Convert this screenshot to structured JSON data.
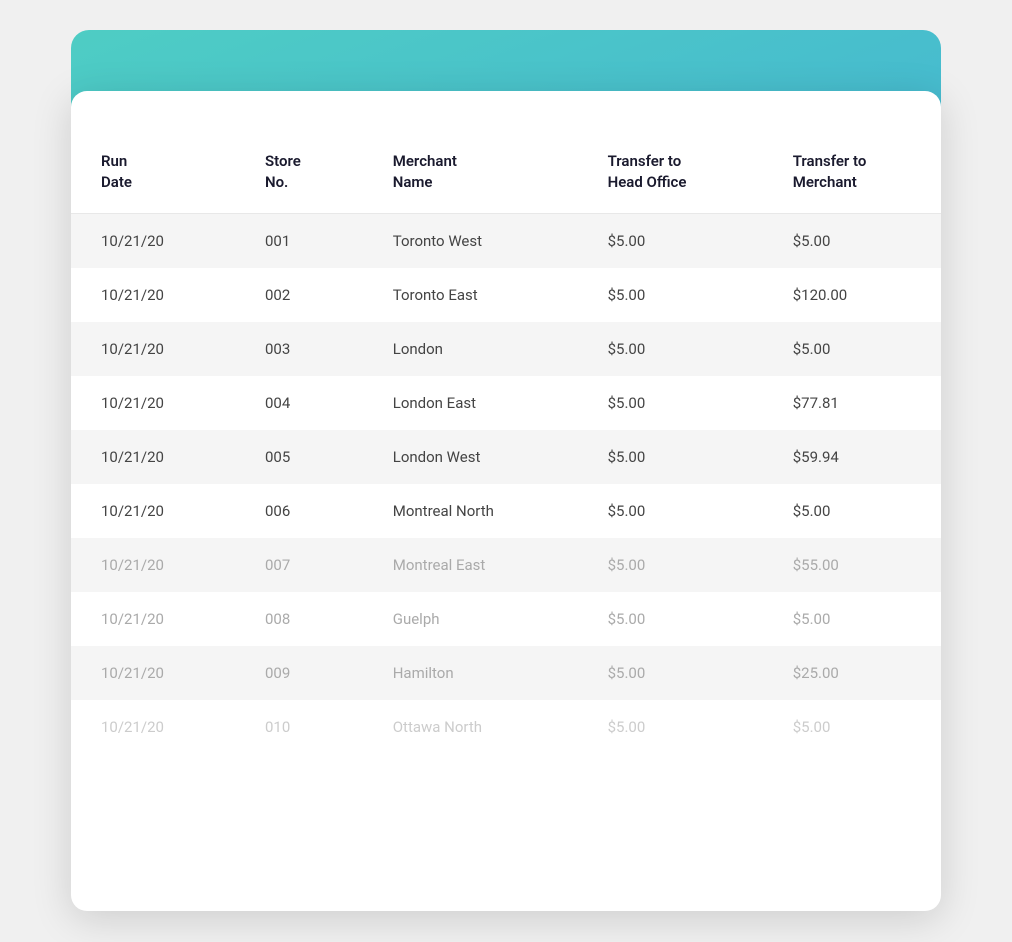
{
  "table": {
    "columns": [
      {
        "key": "run_date",
        "label": "Run\nDate"
      },
      {
        "key": "store_no",
        "label": "Store\nNo."
      },
      {
        "key": "merchant_name",
        "label": "Merchant\nName"
      },
      {
        "key": "transfer_head_office",
        "label": "Transfer to\nHead Office"
      },
      {
        "key": "transfer_merchant",
        "label": "Transfer to\nMerchant"
      }
    ],
    "rows": [
      {
        "run_date": "10/21/20",
        "store_no": "001",
        "merchant_name": "Toronto West",
        "transfer_head_office": "$5.00",
        "transfer_merchant": "$5.00",
        "style": "normal"
      },
      {
        "run_date": "10/21/20",
        "store_no": "002",
        "merchant_name": "Toronto East",
        "transfer_head_office": "$5.00",
        "transfer_merchant": "$120.00",
        "style": "normal"
      },
      {
        "run_date": "10/21/20",
        "store_no": "003",
        "merchant_name": "London",
        "transfer_head_office": "$5.00",
        "transfer_merchant": "$5.00",
        "style": "normal"
      },
      {
        "run_date": "10/21/20",
        "store_no": "004",
        "merchant_name": "London East",
        "transfer_head_office": "$5.00",
        "transfer_merchant": "$77.81",
        "style": "normal"
      },
      {
        "run_date": "10/21/20",
        "store_no": "005",
        "merchant_name": "London West",
        "transfer_head_office": "$5.00",
        "transfer_merchant": "$59.94",
        "style": "normal"
      },
      {
        "run_date": "10/21/20",
        "store_no": "006",
        "merchant_name": "Montreal North",
        "transfer_head_office": "$5.00",
        "transfer_merchant": "$5.00",
        "style": "normal"
      },
      {
        "run_date": "10/21/20",
        "store_no": "007",
        "merchant_name": "Montreal East",
        "transfer_head_office": "$5.00",
        "transfer_merchant": "$55.00",
        "style": "faded"
      },
      {
        "run_date": "10/21/20",
        "store_no": "008",
        "merchant_name": "Guelph",
        "transfer_head_office": "$5.00",
        "transfer_merchant": "$5.00",
        "style": "faded"
      },
      {
        "run_date": "10/21/20",
        "store_no": "009",
        "merchant_name": "Hamilton",
        "transfer_head_office": "$5.00",
        "transfer_merchant": "$25.00",
        "style": "faded"
      },
      {
        "run_date": "10/21/20",
        "store_no": "010",
        "merchant_name": "Ottawa North",
        "transfer_head_office": "$5.00",
        "transfer_merchant": "$5.00",
        "style": "very-faded"
      }
    ]
  }
}
